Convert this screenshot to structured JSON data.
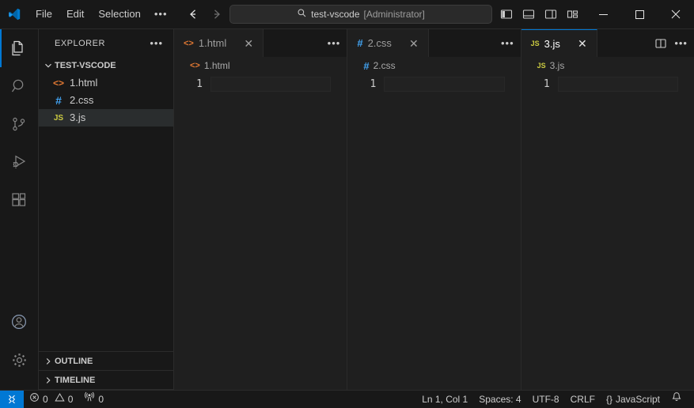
{
  "titlebar": {
    "logo_icon": "vscode-logo-icon",
    "menus": [
      "File",
      "Edit",
      "Selection"
    ],
    "more_menus_label": "•••",
    "back_icon": "arrow-left-icon",
    "forward_icon": "arrow-right-icon",
    "quick_input": {
      "search_icon": "search-icon",
      "text": "test-vscode",
      "admin": "[Administrator]"
    },
    "layout_buttons": [
      {
        "name": "toggle-primary-sidebar",
        "icon": "layout-sidebar-left-icon"
      },
      {
        "name": "toggle-panel",
        "icon": "layout-panel-bottom-icon"
      },
      {
        "name": "toggle-secondary-sidebar",
        "icon": "layout-sidebar-right-icon"
      },
      {
        "name": "customize-layout",
        "icon": "layout-customize-icon"
      }
    ],
    "window_controls": [
      {
        "name": "minimize-button",
        "glyph": "─"
      },
      {
        "name": "maximize-button",
        "glyph": "□"
      },
      {
        "name": "close-button",
        "glyph": "✕"
      }
    ]
  },
  "activitybar": {
    "items": [
      {
        "name": "explorer",
        "icon": "files-icon",
        "active": true
      },
      {
        "name": "search",
        "icon": "search-icon",
        "active": false
      },
      {
        "name": "source-control",
        "icon": "source-control-icon",
        "active": false
      },
      {
        "name": "run-and-debug",
        "icon": "debug-icon",
        "active": false
      },
      {
        "name": "extensions",
        "icon": "extensions-icon",
        "active": false
      }
    ],
    "bottom_items": [
      {
        "name": "accounts",
        "icon": "account-icon"
      },
      {
        "name": "manage-settings",
        "icon": "gear-icon"
      }
    ]
  },
  "sidebar": {
    "title": "EXPLORER",
    "more_actions_label": "•••",
    "folder": {
      "name": "TEST-VSCODE",
      "expanded": true,
      "files": [
        {
          "label": "1.html",
          "icon_text": "<>",
          "icon_kind": "html",
          "selected": false
        },
        {
          "label": "2.css",
          "icon_text": "#",
          "icon_kind": "css",
          "selected": false
        },
        {
          "label": "3.js",
          "icon_text": "JS",
          "icon_kind": "js",
          "selected": true
        }
      ]
    },
    "sections": [
      {
        "label": "OUTLINE",
        "expanded": false
      },
      {
        "label": "TIMELINE",
        "expanded": false
      }
    ]
  },
  "editor_groups": [
    {
      "tab": {
        "label": "1.html",
        "icon_text": "<>",
        "icon_kind": "html",
        "active": false,
        "close_glyph": "✕"
      },
      "breadcrumb": {
        "label": "1.html",
        "icon_text": "<>",
        "icon_kind": "html"
      },
      "line_number": "1",
      "actions": {
        "dots": "•••"
      }
    },
    {
      "tab": {
        "label": "2.css",
        "icon_text": "#",
        "icon_kind": "css",
        "active": false,
        "close_glyph": "✕"
      },
      "breadcrumb": {
        "label": "2.css",
        "icon_text": "#",
        "icon_kind": "css"
      },
      "line_number": "1",
      "actions": {
        "dots": "•••"
      }
    },
    {
      "tab": {
        "label": "3.js",
        "icon_text": "JS",
        "icon_kind": "js",
        "active": true,
        "close_glyph": "✕"
      },
      "breadcrumb": {
        "label": "3.js",
        "icon_text": "JS",
        "icon_kind": "js"
      },
      "line_number": "1",
      "actions": {
        "split_icon": "split-editor-icon",
        "dots": "•••"
      }
    }
  ],
  "statusbar": {
    "remote_icon": "remote-host-icon",
    "errors": "0",
    "warnings": "0",
    "ports": "0",
    "cursor_position": "Ln 1, Col 1",
    "indentation": "Spaces: 4",
    "encoding": "UTF-8",
    "eol": "CRLF",
    "language": "JavaScript",
    "language_icon": "{}",
    "notifications_icon": "bell-icon"
  },
  "colors": {
    "accent": "#0078d4",
    "titlebar_bg": "#181818",
    "editor_bg": "#1f1f1f",
    "selection_bg": "#2a2d2e",
    "html_icon": "#e37933",
    "css_icon": "#42a5f5",
    "js_icon": "#cbcb41"
  }
}
